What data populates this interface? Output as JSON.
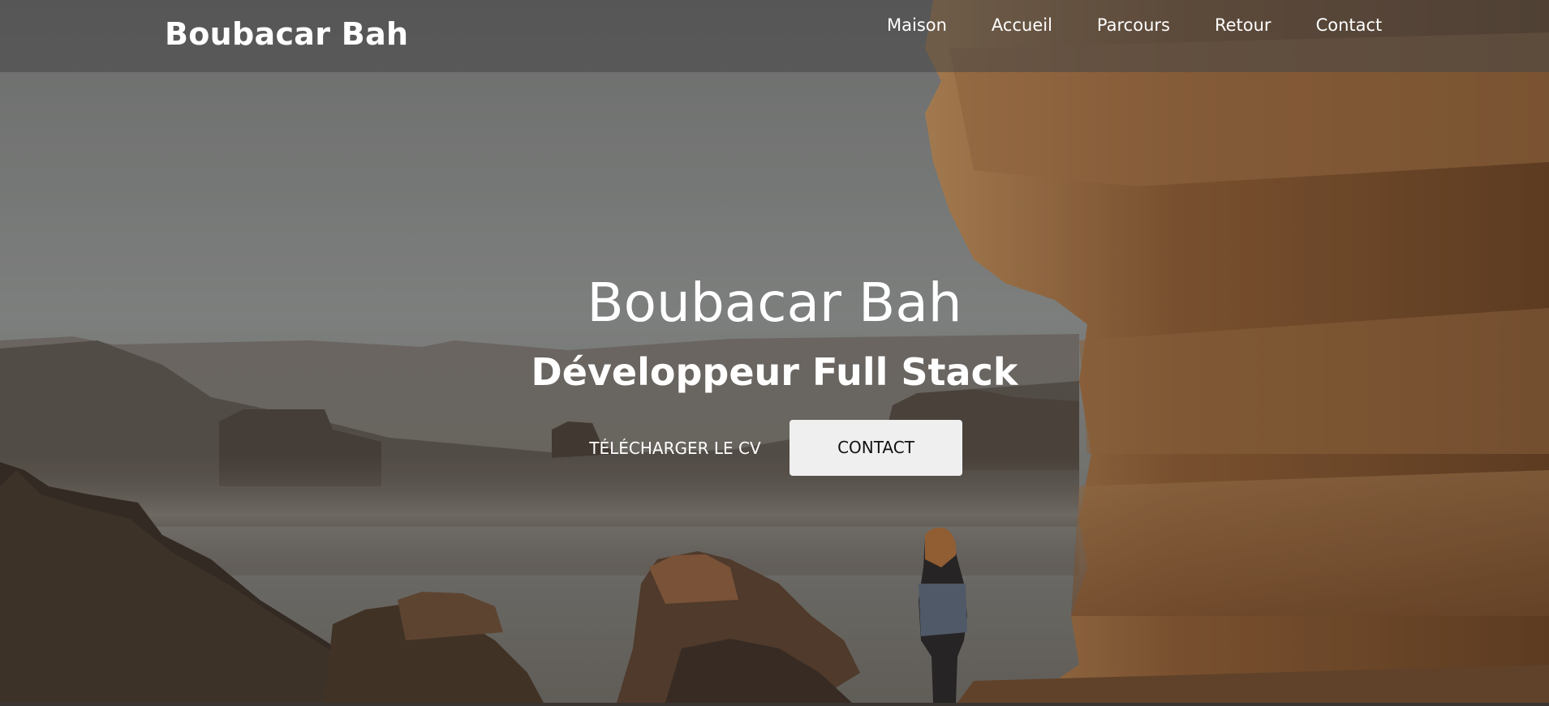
{
  "brand": "Boubacar Bah",
  "nav": {
    "items": [
      "Maison",
      "Accueil",
      "Parcours",
      "Retour",
      "Contact"
    ]
  },
  "hero": {
    "title": "Boubacar Bah",
    "subtitle": "Développeur Full Stack",
    "download_cv_label": "TÉLÉCHARGER LE CV",
    "contact_label": "CONTACT"
  },
  "colors": {
    "navbar_bg": "#4a4a4a",
    "text": "#ffffff",
    "button_bg": "#efefef",
    "button_text": "#111111",
    "sky": "#8c8f8e",
    "rock": "#9a6b40"
  }
}
